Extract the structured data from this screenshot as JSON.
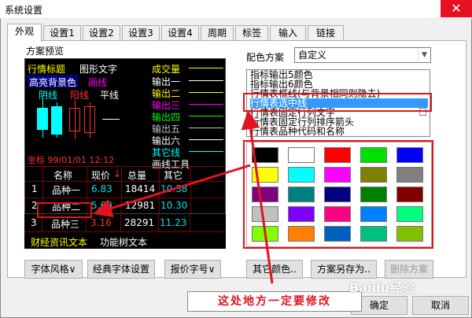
{
  "window": {
    "title": "系统设置",
    "close_glyph": "✕"
  },
  "tabs": [
    "外观",
    "设置1",
    "设置2",
    "设置3",
    "设置4",
    "周期",
    "标签",
    "输入",
    "链接"
  ],
  "preview": {
    "section_label": "方案预览",
    "title_text": "行情标题",
    "graphic_text": "图形文字",
    "hilite_bg": "高亮背景色",
    "draw_line": "画线",
    "yin_line": "阴线",
    "yang_line": "阳线",
    "flat_line": "平线",
    "indicators": [
      "成交量",
      "输出一",
      "输出二",
      "输出三",
      "输出四",
      "输出五",
      "输出六",
      "其它线",
      "画线工具"
    ],
    "coord": "坐标 99/01/01 12:12",
    "table": {
      "headers": [
        "名称",
        "现价",
        "总量",
        "其它"
      ],
      "rows": [
        {
          "idx": "1",
          "name": "品种一",
          "price": "6.83",
          "vol": "18414",
          "other": "10.38"
        },
        {
          "idx": "2",
          "name": "品种二",
          "price": "5.69",
          "vol": "12981",
          "other": "10.30"
        },
        {
          "idx": "3",
          "name": "品种三",
          "price": "3.16",
          "vol": "28291",
          "other": "11.23"
        }
      ]
    },
    "footer_left": "财经资讯文本",
    "footer_right": "功能树文本"
  },
  "bottom_buttons": [
    "字体风格∨",
    "经典字体设置",
    "报价字号∨"
  ],
  "scheme": {
    "label": "配色方案",
    "selected": "自定义",
    "items": [
      "指标输出5颜色",
      "指标输出6颜色",
      "行情表框线(与背景相同则隐去)",
      "行情表选中线",
      "行情表固定行列文字",
      "行情表固定行列排序箭头",
      "行情表品种代码和名称"
    ],
    "selected_index": 3
  },
  "palette": [
    [
      "#000000",
      "#ffffff",
      "#ff0000",
      "#00e000",
      "#0000ff"
    ],
    [
      "#ffff00",
      "#00ffff",
      "#ff00ff",
      "#808000",
      "#808080"
    ],
    [
      "#800080",
      "#008080",
      "#000080",
      "#008000",
      "#800000"
    ],
    [
      "#c0c0c0",
      "#8000ff",
      "#ff0080",
      "#0080ff",
      "#00ff80"
    ],
    [
      "#80ff00",
      "#ff8000",
      "#0060c0",
      "#00c080",
      "#80c000"
    ]
  ],
  "scheme_buttons": [
    "其它颜色..",
    "方案另存为..",
    "删除方案"
  ],
  "dialog_buttons": [
    "确定",
    "取消"
  ],
  "annotation": "这处地方一定要修改",
  "watermark": "Baidu经验",
  "colors": {
    "accent": "#e0141e",
    "select_blue": "#3399ff"
  }
}
